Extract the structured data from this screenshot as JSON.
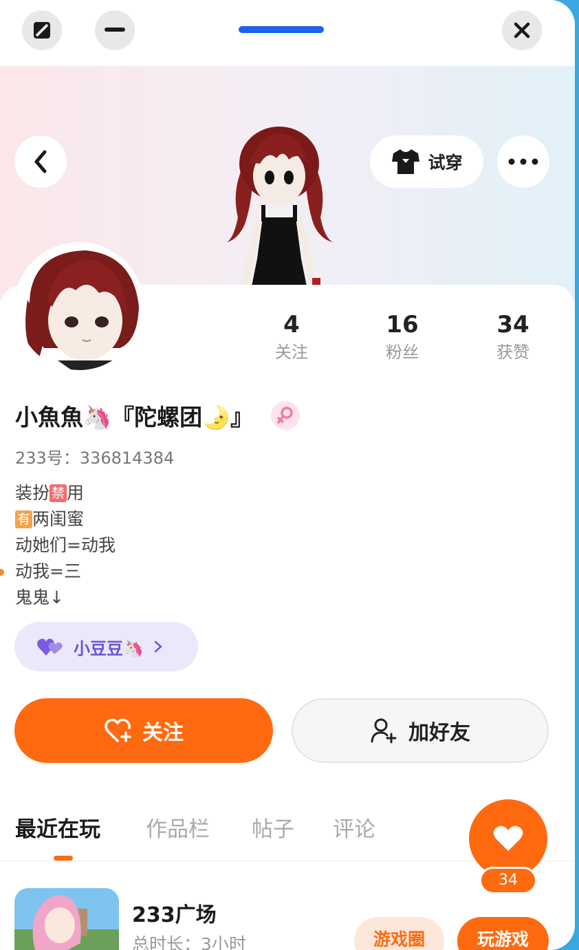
{
  "window": {
    "expand_icon": "expand-icon",
    "minimize_icon": "minimize-icon",
    "close_icon": "close-icon"
  },
  "header": {
    "back_icon": "back-arrow-icon",
    "tryon_label": "试穿",
    "more_icon": "more-dots-icon"
  },
  "stats": [
    {
      "value": "4",
      "label": "关注"
    },
    {
      "value": "16",
      "label": "粉丝"
    },
    {
      "value": "34",
      "label": "获赞"
    }
  ],
  "profile": {
    "name": "小魚魚🦄『陀螺团🌛』",
    "gender": "female",
    "uid": "233号：336814384",
    "bio_line1_a": "装扮",
    "bio_line1_tag": "禁",
    "bio_line1_b": "用",
    "bio_line2_tag": "有",
    "bio_line2_b": "两闺蜜",
    "bio_line3": "动她们=动我",
    "bio_line4": "动我=三",
    "bio_line5": "鬼鬼↓"
  },
  "bestie": {
    "label": "小豆豆🦄"
  },
  "actions": {
    "follow_label": "关注",
    "add_friend_label": "加好友"
  },
  "tabs": [
    {
      "label": "最近在玩",
      "active": true
    },
    {
      "label": "作品栏",
      "active": false
    },
    {
      "label": "帖子",
      "active": false
    },
    {
      "label": "评论",
      "active": false
    }
  ],
  "likes": {
    "count": "34"
  },
  "game": {
    "title": "233广场",
    "playtime": "总时长：3小时",
    "circle_label": "游戏圈",
    "play_label": "玩游戏"
  },
  "colors": {
    "accent": "#ff6a10",
    "handle": "#1a62e8",
    "bestie_bg": "#ece8fb",
    "bestie_text": "#6a55d9"
  }
}
